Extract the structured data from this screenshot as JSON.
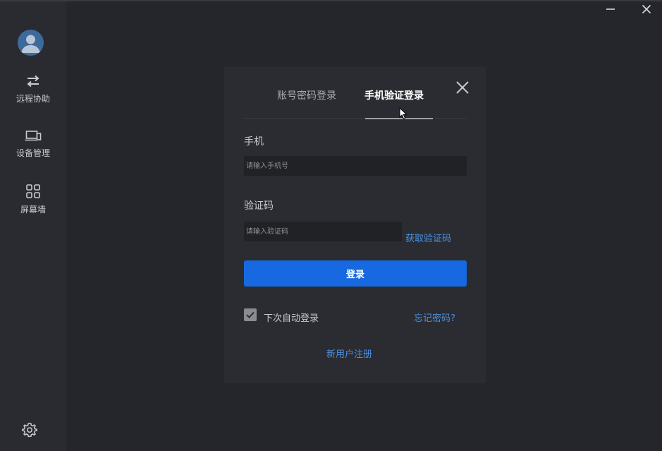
{
  "sidebar": {
    "items": [
      {
        "label": "远程协助",
        "icon": "swap-arrows-icon"
      },
      {
        "label": "设备管理",
        "icon": "devices-icon"
      },
      {
        "label": "屏幕墙",
        "icon": "grid-icon"
      }
    ],
    "settings_icon": "gear-icon"
  },
  "dialog": {
    "tabs": [
      {
        "label": "账号密码登录",
        "active": false
      },
      {
        "label": "手机验证登录",
        "active": true
      }
    ],
    "phone": {
      "label": "手机",
      "placeholder": "请输入手机号",
      "value": ""
    },
    "code": {
      "label": "验证码",
      "placeholder": "请输入验证码",
      "value": "",
      "get_code_label": "获取验证码"
    },
    "login_label": "登录",
    "auto_login": {
      "label": "下次自动登录",
      "checked": true
    },
    "forgot_label": "忘记密码?",
    "register_label": "新用户注册"
  },
  "colors": {
    "accent": "#1669e0",
    "link": "#4a90e2",
    "background": "#25262b",
    "sidebar": "#2a2b30",
    "dialog": "#2b2c31"
  }
}
